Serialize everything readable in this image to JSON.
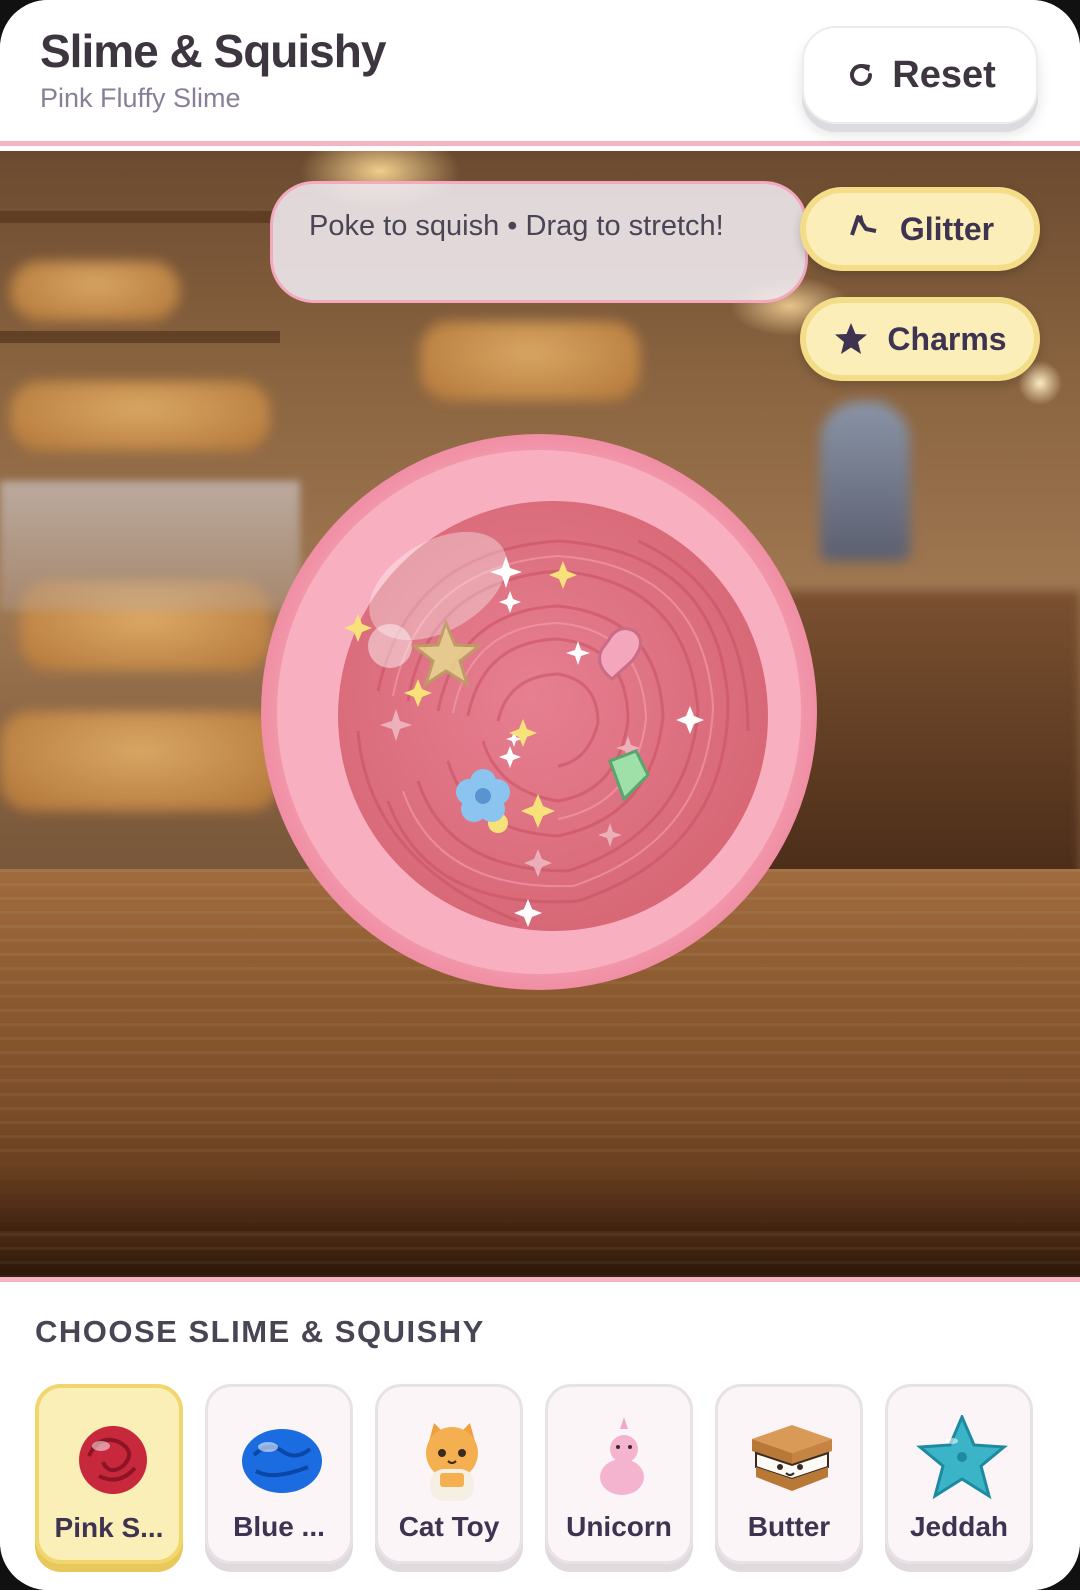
{
  "header": {
    "title": "Slime & Squishy",
    "subtitle": "Pink Fluffy Slime",
    "reset_label": "Reset"
  },
  "scene": {
    "hint": "Poke to squish • Drag to stretch!",
    "glitter_label": "Glitter",
    "charms_label": "Charms"
  },
  "chooser": {
    "label": "CHOOSE SLIME & SQUISHY",
    "items": [
      {
        "label": "Pink S...",
        "icon": "pink-slime-icon",
        "selected": true
      },
      {
        "label": "Blue ...",
        "icon": "blue-slime-icon",
        "selected": false
      },
      {
        "label": "Cat Toy",
        "icon": "cat-toy-icon",
        "selected": false
      },
      {
        "label": "Unicorn",
        "icon": "unicorn-icon",
        "selected": false
      },
      {
        "label": "Butter",
        "icon": "butter-sandwich-icon",
        "selected": false
      },
      {
        "label": "Jeddah",
        "icon": "star-squishy-icon",
        "selected": false
      }
    ]
  },
  "colors": {
    "accent_pink": "#f6b3c2",
    "pill_yellow": "#fbeeb8",
    "slime_pink": "#f4a0b4"
  }
}
